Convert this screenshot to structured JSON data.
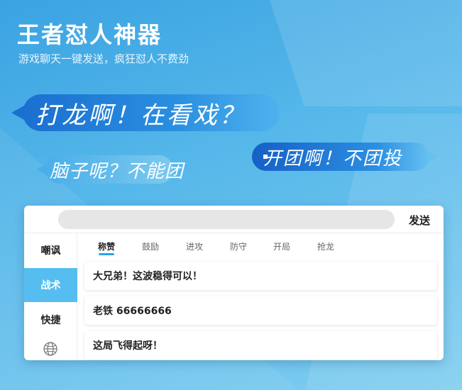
{
  "app": {
    "title": "王者怼人神器",
    "subtitle": "游戏聊天一键发送，疯狂怼人不费劲"
  },
  "bubbles": [
    "打龙啊！在看戏？",
    "脑子呢？不能团",
    "开团啊！不团投"
  ],
  "chat": {
    "input_value": "",
    "send_label": "发送"
  },
  "sidebar": {
    "items": [
      {
        "label": "嘲讽",
        "active": false
      },
      {
        "label": "战术",
        "active": true
      },
      {
        "label": "快捷",
        "active": false
      }
    ],
    "bottom_icon": "globe-icon"
  },
  "tabs": [
    {
      "label": "称赞",
      "active": true
    },
    {
      "label": "鼓励",
      "active": false
    },
    {
      "label": "进攻",
      "active": false
    },
    {
      "label": "防守",
      "active": false
    },
    {
      "label": "开局",
      "active": false
    },
    {
      "label": "抢龙",
      "active": false
    }
  ],
  "phrases": [
    "大兄弟！这波稳得可以！",
    "老铁 66666666",
    "这局飞得起呀！"
  ],
  "colors": {
    "accent": "#56bdf0",
    "tab_indicator": "#2ba3e8",
    "bubble_dark": "#1b6fd0"
  }
}
